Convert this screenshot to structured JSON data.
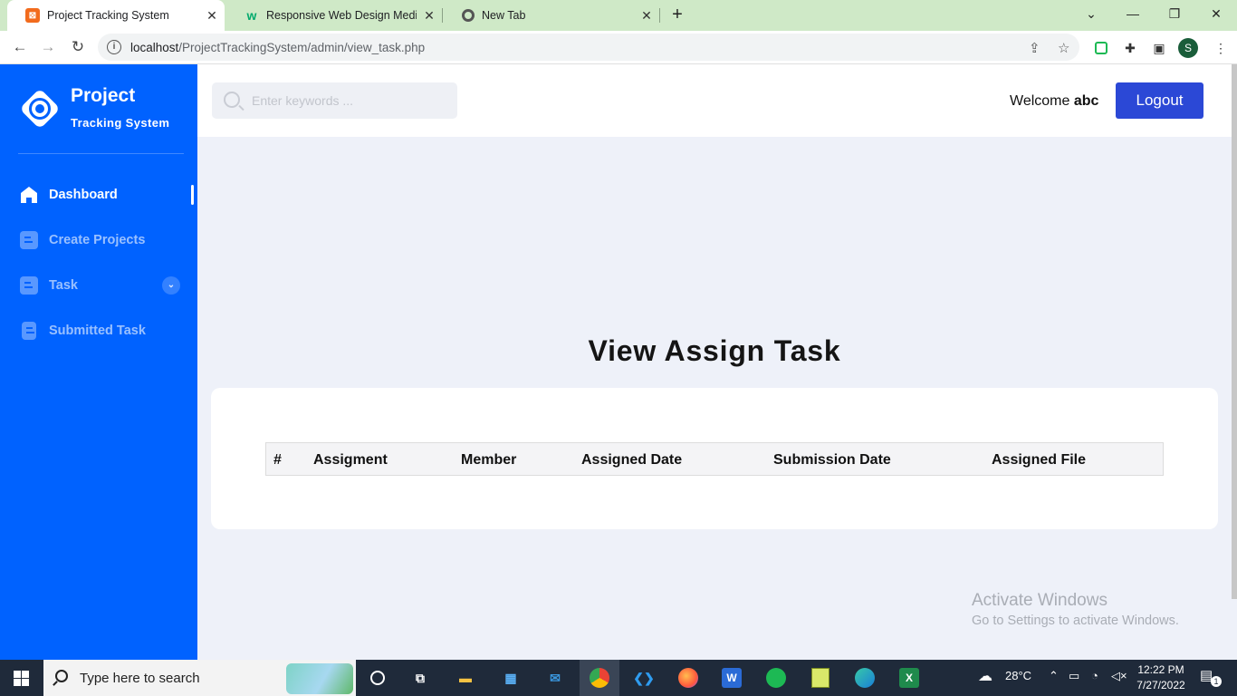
{
  "browser": {
    "tabs": [
      {
        "title": "Project Tracking System",
        "favicon": "xampp-icon",
        "active": true
      },
      {
        "title": "Responsive Web Design Media C",
        "favicon": "w3schools-icon",
        "active": false
      },
      {
        "title": "New Tab",
        "favicon": "chrome-icon",
        "active": false
      }
    ],
    "url": "localhost/ProjectTrackingSystem/admin/view_task.php",
    "url_host": "localhost",
    "url_path": "/ProjectTrackingSystem/admin/view_task.php",
    "profile_initial": "S"
  },
  "sidebar": {
    "brand_title": "Project",
    "brand_subtitle": "Tracking System",
    "items": [
      {
        "label": "Dashboard",
        "icon": "home-icon",
        "active": true
      },
      {
        "label": "Create Projects",
        "icon": "document-icon",
        "active": false
      },
      {
        "label": "Task",
        "icon": "document-icon",
        "active": false,
        "has_dropdown": true
      },
      {
        "label": "Submitted Task",
        "icon": "file-icon",
        "active": false
      }
    ]
  },
  "header": {
    "search_placeholder": "Enter keywords ...",
    "welcome_text": "Welcome",
    "username": "abc",
    "logout_label": "Logout"
  },
  "main": {
    "title": "View Assign Task",
    "table": {
      "columns": [
        "#",
        "Assigment",
        "Member",
        "Assigned Date",
        "Submission Date",
        "Assigned File"
      ],
      "rows": []
    }
  },
  "watermark": {
    "line1": "Activate Windows",
    "line2": "Go to Settings to activate Windows."
  },
  "taskbar": {
    "search_placeholder": "Type here to search",
    "weather": "28°C",
    "time": "12:22 PM",
    "date": "7/27/2022",
    "notification_count": "1"
  },
  "colors": {
    "sidebar_bg": "#0062ff",
    "logout_bg": "#2b48d6",
    "page_bg": "#eef1f9",
    "tabbar_bg": "#cfe9c7"
  }
}
